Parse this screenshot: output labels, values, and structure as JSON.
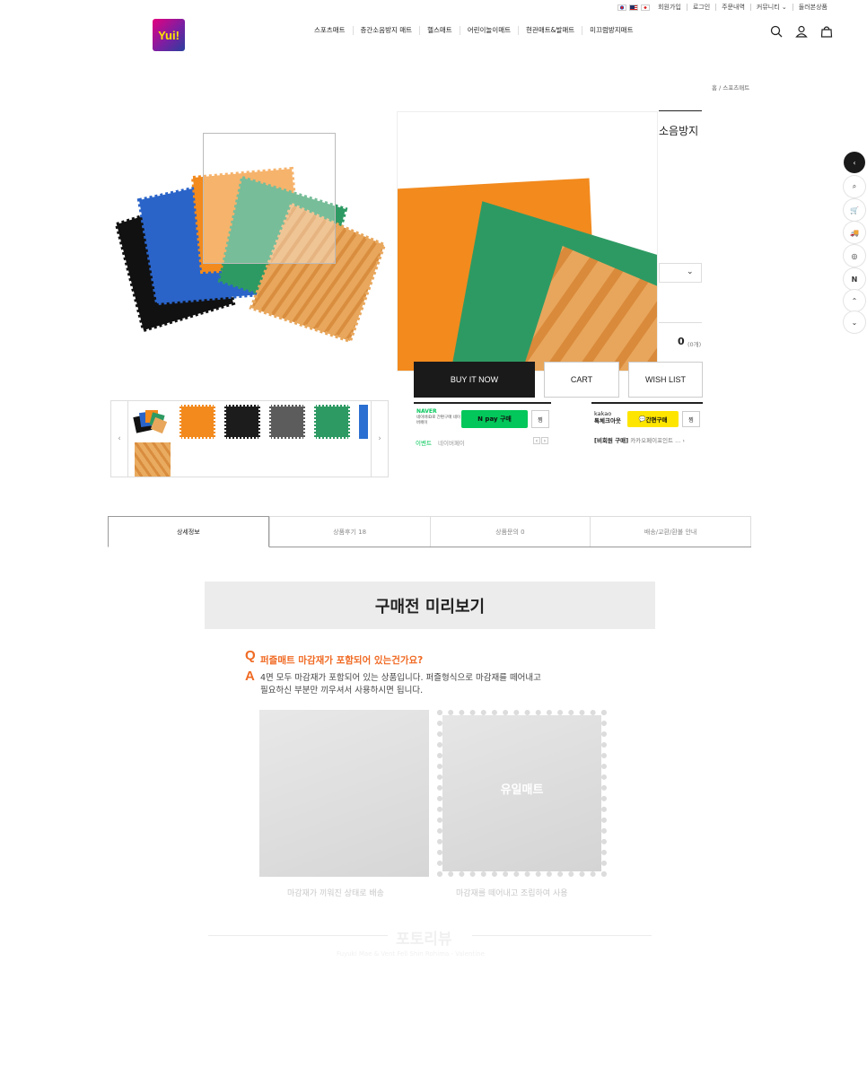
{
  "util": {
    "join": "회원가입",
    "login": "로그인",
    "orders": "주문내역",
    "community": "커뮤니티",
    "viewed": "둘러본상품"
  },
  "logo": {
    "text": "Yui!"
  },
  "nav": [
    "스포츠매트",
    "층간소음방지 매트",
    "헬스매트",
    "어린이놀이매트",
    "현관매트&발매트",
    "미끄럼방지매트"
  ],
  "breadcrumb": "홈 / 스포츠매트",
  "product": {
    "title_fragment": "소음방지",
    "total_value": "0",
    "total_count": "(0개)"
  },
  "buttons": {
    "buy": "BUY IT NOW",
    "cart": "CART",
    "wish": "WISH LIST"
  },
  "npay": {
    "brand": "NAVER",
    "sub": "네이버ID로 간편구매 네이버페이",
    "pay_label": "N pay 구매",
    "zzim": "찜",
    "event_label": "이벤트",
    "event_text": "네이버페이"
  },
  "kakao": {
    "brand": "kakao",
    "sub": "톡체크아웃",
    "pay_label": "간편구매",
    "zzim": "찜",
    "promo_bold": "[비회원 구매]",
    "promo_text": "카카오페이포인트 ..."
  },
  "thumbnails": [
    {
      "color": "#f28a1e"
    },
    {
      "color": "#1c1c1c"
    },
    {
      "color": "#5c5c5c"
    },
    {
      "color": "#2e9a63"
    },
    {
      "color": "#2a6fd1"
    }
  ],
  "tabs": [
    {
      "label": "상세정보",
      "active": true
    },
    {
      "label": "상품후기 18",
      "active": false
    },
    {
      "label": "상품문의 0",
      "active": false
    },
    {
      "label": "배송/교환/환불 안내",
      "active": false
    }
  ],
  "detail": {
    "preview_title": "구매전 미리보기",
    "q_mark": "Q",
    "a_mark": "A",
    "question": "퍼즐매트 마감재가 포함되어 있는건가요?",
    "answer_line1": "4면 모두 마감재가 포함되어 있는 상품입니다. 퍼즐형식으로 마감재를 떼어내고",
    "answer_line2": "필요하신 부분만 끼우셔서 사용하시면 됩니다.",
    "sample_watermark": "유일매트",
    "caption1": "마감재가 끼워진 상태로 배송",
    "caption2": "마감재를 떼어내고 조립하여 사용",
    "photo_title": "포토리뷰",
    "photo_sub": "Fuyuki Mae & Vent Fell Shin Rohima - Valentine"
  },
  "colors": {
    "accent": "#f06a23",
    "naver": "#03c75a",
    "kakao": "#fee500",
    "dark": "#1a1a1a"
  }
}
